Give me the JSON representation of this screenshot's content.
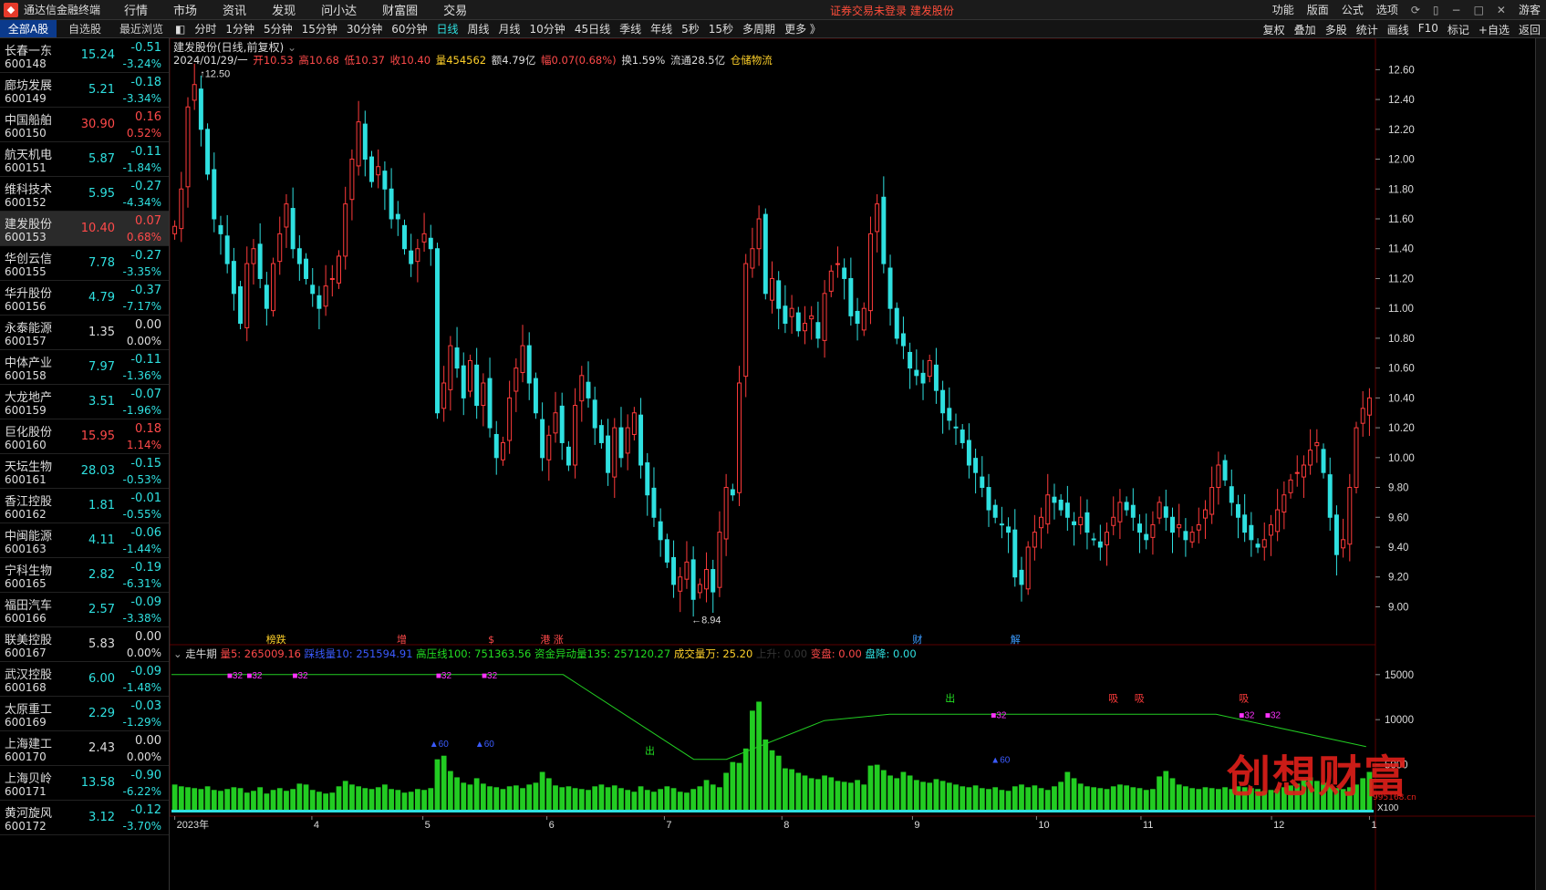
{
  "app": {
    "title": "通达信金融终端",
    "status": "证券交易未登录   建发股份"
  },
  "menus": [
    "行情",
    "市场",
    "资讯",
    "发现",
    "问小达",
    "财富圈",
    "交易"
  ],
  "top_right": [
    "功能",
    "版面",
    "公式",
    "选项",
    "游客"
  ],
  "list_tabs": [
    "全部A股",
    "自选股",
    "最近浏览"
  ],
  "stocks": [
    {
      "name": "长春一东",
      "code": "600148",
      "price": "15.24",
      "chg": "-0.51",
      "pct": "-3.24%",
      "dir": "down"
    },
    {
      "name": "廊坊发展",
      "code": "600149",
      "price": "5.21",
      "chg": "-0.18",
      "pct": "-3.34%",
      "dir": "down"
    },
    {
      "name": "中国船舶",
      "code": "600150",
      "price": "30.90",
      "chg": "0.16",
      "pct": "0.52%",
      "dir": "up"
    },
    {
      "name": "航天机电",
      "code": "600151",
      "price": "5.87",
      "chg": "-0.11",
      "pct": "-1.84%",
      "dir": "down"
    },
    {
      "name": "维科技术",
      "code": "600152",
      "price": "5.95",
      "chg": "-0.27",
      "pct": "-4.34%",
      "dir": "down"
    },
    {
      "name": "建发股份",
      "code": "600153",
      "price": "10.40",
      "chg": "0.07",
      "pct": "0.68%",
      "dir": "up"
    },
    {
      "name": "华创云信",
      "code": "600155",
      "price": "7.78",
      "chg": "-0.27",
      "pct": "-3.35%",
      "dir": "down"
    },
    {
      "name": "华升股份",
      "code": "600156",
      "price": "4.79",
      "chg": "-0.37",
      "pct": "-7.17%",
      "dir": "down"
    },
    {
      "name": "永泰能源",
      "code": "600157",
      "price": "1.35",
      "chg": "0.00",
      "pct": "0.00%",
      "dir": "flat"
    },
    {
      "name": "中体产业",
      "code": "600158",
      "price": "7.97",
      "chg": "-0.11",
      "pct": "-1.36%",
      "dir": "down"
    },
    {
      "name": "大龙地产",
      "code": "600159",
      "price": "3.51",
      "chg": "-0.07",
      "pct": "-1.96%",
      "dir": "down"
    },
    {
      "name": "巨化股份",
      "code": "600160",
      "price": "15.95",
      "chg": "0.18",
      "pct": "1.14%",
      "dir": "up"
    },
    {
      "name": "天坛生物",
      "code": "600161",
      "price": "28.03",
      "chg": "-0.15",
      "pct": "-0.53%",
      "dir": "down"
    },
    {
      "name": "香江控股",
      "code": "600162",
      "price": "1.81",
      "chg": "-0.01",
      "pct": "-0.55%",
      "dir": "down"
    },
    {
      "name": "中闽能源",
      "code": "600163",
      "price": "4.11",
      "chg": "-0.06",
      "pct": "-1.44%",
      "dir": "down"
    },
    {
      "name": "宁科生物",
      "code": "600165",
      "price": "2.82",
      "chg": "-0.19",
      "pct": "-6.31%",
      "dir": "down"
    },
    {
      "name": "福田汽车",
      "code": "600166",
      "price": "2.57",
      "chg": "-0.09",
      "pct": "-3.38%",
      "dir": "down"
    },
    {
      "name": "联美控股",
      "code": "600167",
      "price": "5.83",
      "chg": "0.00",
      "pct": "0.00%",
      "dir": "flat"
    },
    {
      "name": "武汉控股",
      "code": "600168",
      "price": "6.00",
      "chg": "-0.09",
      "pct": "-1.48%",
      "dir": "down"
    },
    {
      "name": "太原重工",
      "code": "600169",
      "price": "2.29",
      "chg": "-0.03",
      "pct": "-1.29%",
      "dir": "down"
    },
    {
      "name": "上海建工",
      "code": "600170",
      "price": "2.43",
      "chg": "0.00",
      "pct": "0.00%",
      "dir": "flat"
    },
    {
      "name": "上海贝岭",
      "code": "600171",
      "price": "13.58",
      "chg": "-0.90",
      "pct": "-6.22%",
      "dir": "down"
    },
    {
      "name": "黄河旋风",
      "code": "600172",
      "price": "3.12",
      "chg": "-0.12",
      "pct": "-3.70%",
      "dir": "down"
    }
  ],
  "periods": [
    "分时",
    "1分钟",
    "5分钟",
    "15分钟",
    "30分钟",
    "60分钟",
    "日线",
    "周线",
    "月线",
    "10分钟",
    "45日线",
    "季线",
    "年线",
    "5秒",
    "15秒",
    "多周期",
    "更多 》"
  ],
  "period_active": "日线",
  "period_right": [
    "复权",
    "叠加",
    "多股",
    "统计",
    "画线",
    "F10",
    "标记",
    "+自选",
    "返回"
  ],
  "chart_title": "建发股份(日线,前复权)",
  "ohlc": {
    "date": "2024/01/29/一",
    "open": "开10.53",
    "high": "高10.68",
    "low": "低10.37",
    "close": "收10.40",
    "vol": "量454562",
    "amount": "额4.79亿",
    "range": "幅0.07(0.68%)",
    "turnover": "换1.59%",
    "float": "流通28.5亿",
    "flow": "仓储物流"
  },
  "indicator": {
    "name": "走牛期",
    "vol5": "量5: 265009.16",
    "ma10": "踩线量10: 251594.91",
    "pressure": "高压线100: 751363.56",
    "abnormal": "资金异动量135: 257120.27",
    "deal": "成交量万: 25.20",
    "rise": "上升: 0.00",
    "change": "变盘: 0.00",
    "drop": "盘降: 0.00"
  },
  "event_labels": [
    "榜跌",
    "增",
    "$",
    "港",
    "涨",
    "财",
    "解"
  ],
  "signal_labels": {
    "out": "出",
    "absorb": "吸",
    "mark32": "32",
    "mark60": "60",
    "wm": "创想财富",
    "wm_url": "995168.cn",
    "x100": "X100"
  },
  "x_axis_labels": [
    "2023年",
    "4",
    "5",
    "6",
    "7",
    "8",
    "9",
    "10",
    "11",
    "12",
    "1"
  ],
  "price_axis": [
    "12.60",
    "12.40",
    "12.20",
    "12.00",
    "11.80",
    "11.60",
    "11.40",
    "11.20",
    "11.00",
    "10.80",
    "10.60",
    "10.40",
    "10.20",
    "10.00",
    "9.80",
    "9.60",
    "9.40",
    "9.20",
    "9.00"
  ],
  "vol_axis": [
    "15000",
    "10000",
    "5000"
  ],
  "max_label": "12.50",
  "min_label": "8.94",
  "colors": {
    "up": "#ff3b3b",
    "down": "#2fe0e0",
    "grid": "#3a0000",
    "ma": "#22cc22"
  },
  "chart_data": {
    "type": "candlestick",
    "symbol": "建发股份",
    "ylim": [
      8.85,
      12.7
    ],
    "vol_ylim": [
      0,
      16500
    ],
    "closes": [
      11.55,
      11.8,
      12.35,
      12.5,
      12.2,
      11.9,
      11.6,
      11.5,
      11.3,
      11.1,
      10.9,
      11.3,
      11.4,
      11.2,
      11.0,
      11.3,
      11.5,
      11.7,
      11.4,
      11.3,
      11.2,
      11.1,
      11.0,
      11.15,
      11.2,
      11.35,
      11.7,
      12.0,
      12.25,
      12.0,
      11.85,
      11.95,
      11.8,
      11.6,
      11.6,
      11.4,
      11.3,
      11.4,
      11.5,
      11.4,
      10.3,
      10.5,
      10.75,
      10.6,
      10.4,
      10.65,
      10.35,
      10.5,
      10.2,
      10.0,
      10.1,
      10.4,
      10.6,
      10.75,
      10.5,
      10.3,
      10.0,
      10.15,
      10.3,
      10.1,
      9.95,
      10.35,
      10.55,
      10.4,
      10.2,
      10.1,
      9.9,
      10.2,
      10.0,
      10.2,
      10.3,
      9.95,
      9.75,
      9.6,
      9.45,
      9.3,
      9.15,
      9.2,
      9.3,
      9.05,
      9.15,
      9.25,
      9.1,
      9.5,
      9.8,
      9.75,
      10.5,
      11.3,
      11.4,
      11.6,
      11.1,
      11.2,
      11.0,
      10.9,
      11.0,
      10.85,
      10.9,
      10.95,
      10.8,
      11.1,
      11.25,
      11.3,
      11.2,
      10.95,
      10.9,
      11.0,
      11.5,
      11.7,
      11.3,
      11.0,
      10.8,
      10.75,
      10.6,
      10.55,
      10.5,
      10.65,
      10.45,
      10.3,
      10.25,
      10.2,
      10.1,
      9.95,
      9.9,
      9.8,
      9.65,
      9.6,
      9.55,
      9.5,
      9.2,
      9.15,
      9.4,
      9.5,
      9.6,
      9.75,
      9.7,
      9.65,
      9.6,
      9.55,
      9.6,
      9.5,
      9.45,
      9.4,
      9.5,
      9.6,
      9.7,
      9.65,
      9.6,
      9.5,
      9.45,
      9.55,
      9.7,
      9.6,
      9.5,
      9.55,
      9.45,
      9.5,
      9.55,
      9.65,
      9.8,
      9.95,
      9.85,
      9.7,
      9.6,
      9.5,
      9.45,
      9.4,
      9.45,
      9.55,
      9.65,
      9.75,
      9.85,
      9.9,
      9.95,
      10.05,
      10.1,
      9.9,
      9.6,
      9.35,
      9.45,
      9.8,
      10.2,
      10.33,
      10.4
    ],
    "volumes": [
      2800,
      2600,
      2500,
      2400,
      2300,
      2600,
      2200,
      2100,
      2300,
      2500,
      2400,
      1900,
      2100,
      2500,
      1800,
      2200,
      2400,
      2100,
      2300,
      2900,
      2800,
      2200,
      2000,
      1800,
      1900,
      2600,
      3200,
      2800,
      2600,
      2400,
      2300,
      2500,
      2800,
      2300,
      2200,
      1900,
      2000,
      2300,
      2200,
      2400,
      5600,
      6000,
      4300,
      3600,
      3000,
      2800,
      3500,
      2900,
      2600,
      2500,
      2300,
      2600,
      2700,
      2400,
      2800,
      3000,
      4200,
      3500,
      2700,
      2500,
      2600,
      2400,
      2300,
      2200,
      2600,
      2800,
      2500,
      2700,
      2400,
      2200,
      2000,
      2600,
      2200,
      2000,
      2300,
      2600,
      2400,
      2000,
      1900,
      2300,
      2600,
      3300,
      2800,
      2500,
      4100,
      5300,
      5200,
      6800,
      11000,
      12000,
      7800,
      6600,
      6000,
      4600,
      4500,
      4100,
      3800,
      3500,
      3400,
      3800,
      3600,
      3200,
      3100,
      3000,
      3300,
      2800,
      4900,
      5000,
      4400,
      3800,
      3500,
      4200,
      3800,
      3300,
      3100,
      3000,
      3400,
      3200,
      3000,
      2800,
      2600,
      2500,
      2700,
      2400,
      2300,
      2500,
      2200,
      2100,
      2600,
      2800,
      2500,
      2700,
      2400,
      2200,
      2600,
      3100,
      4200,
      3500,
      2900,
      2600,
      2500,
      2400,
      2300,
      2600,
      2800,
      2700,
      2500,
      2400,
      2200,
      2300,
      3700,
      4300,
      3500,
      2800,
      2600,
      2400,
      2300,
      2500,
      2400,
      2300,
      2500,
      2300,
      2600,
      2500,
      2400,
      2300,
      2100,
      2200,
      2300,
      2500,
      2700,
      2900,
      3400,
      3600,
      3200,
      3000,
      2600,
      2400,
      2300,
      2500,
      2800,
      3500,
      4200,
      4000
    ],
    "pressure_line": [
      {
        "x": 0,
        "y": 15000
      },
      {
        "x": 60,
        "y": 15000
      },
      {
        "x": 80,
        "y": 5600
      },
      {
        "x": 85,
        "y": 5600
      },
      {
        "x": 100,
        "y": 9900
      },
      {
        "x": 110,
        "y": 10600
      },
      {
        "x": 160,
        "y": 10600
      },
      {
        "x": 183,
        "y": 7000
      }
    ]
  }
}
